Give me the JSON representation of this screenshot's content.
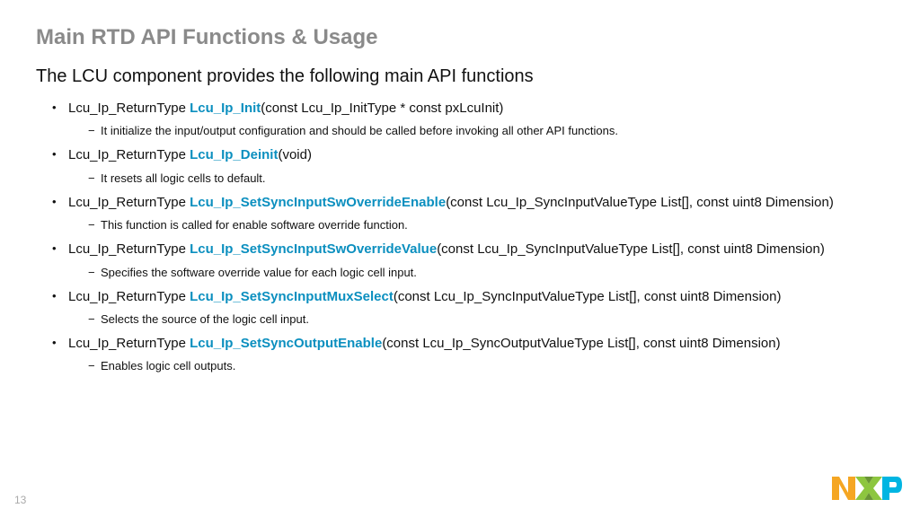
{
  "title": "Main RTD API Functions & Usage",
  "subtitle": "The LCU component provides the following main API functions",
  "items": [
    {
      "ret": "Lcu_Ip_ReturnType ",
      "fn": "Lcu_Ip_Init",
      "sig": "(const Lcu_Ip_InitType * const pxLcuInit)",
      "desc": "It initialize the input/output configuration and should be called before invoking all other API functions."
    },
    {
      "ret": "Lcu_Ip_ReturnType ",
      "fn": "Lcu_Ip_Deinit",
      "sig": "(void)",
      "desc": "It resets all logic cells to default."
    },
    {
      "ret": "Lcu_Ip_ReturnType ",
      "fn": "Lcu_Ip_SetSyncInputSwOverrideEnable",
      "sig": "(const Lcu_Ip_SyncInputValueType List[], const uint8 Dimension)",
      "desc": "This function is called for enable software override function."
    },
    {
      "ret": "Lcu_Ip_ReturnType ",
      "fn": "Lcu_Ip_SetSyncInputSwOverrideValue",
      "sig": "(const Lcu_Ip_SyncInputValueType List[], const uint8 Dimension)",
      "desc": "Specifies the software override value for each logic cell input."
    },
    {
      "ret": "Lcu_Ip_ReturnType ",
      "fn": "Lcu_Ip_SetSyncInputMuxSelect",
      "sig": "(const Lcu_Ip_SyncInputValueType List[], const uint8 Dimension)",
      "desc": "Selects the source of the logic cell input."
    },
    {
      "ret": "Lcu_Ip_ReturnType ",
      "fn": "Lcu_Ip_SetSyncOutputEnable",
      "sig": "(const Lcu_Ip_SyncOutputValueType List[], const uint8 Dimension)",
      "desc": "Enables logic cell outputs."
    }
  ],
  "pagenum": "13",
  "brand": {
    "accent_orange": "#f5a623",
    "accent_cyan": "#00b5e2",
    "accent_green": "#8dc63f"
  }
}
